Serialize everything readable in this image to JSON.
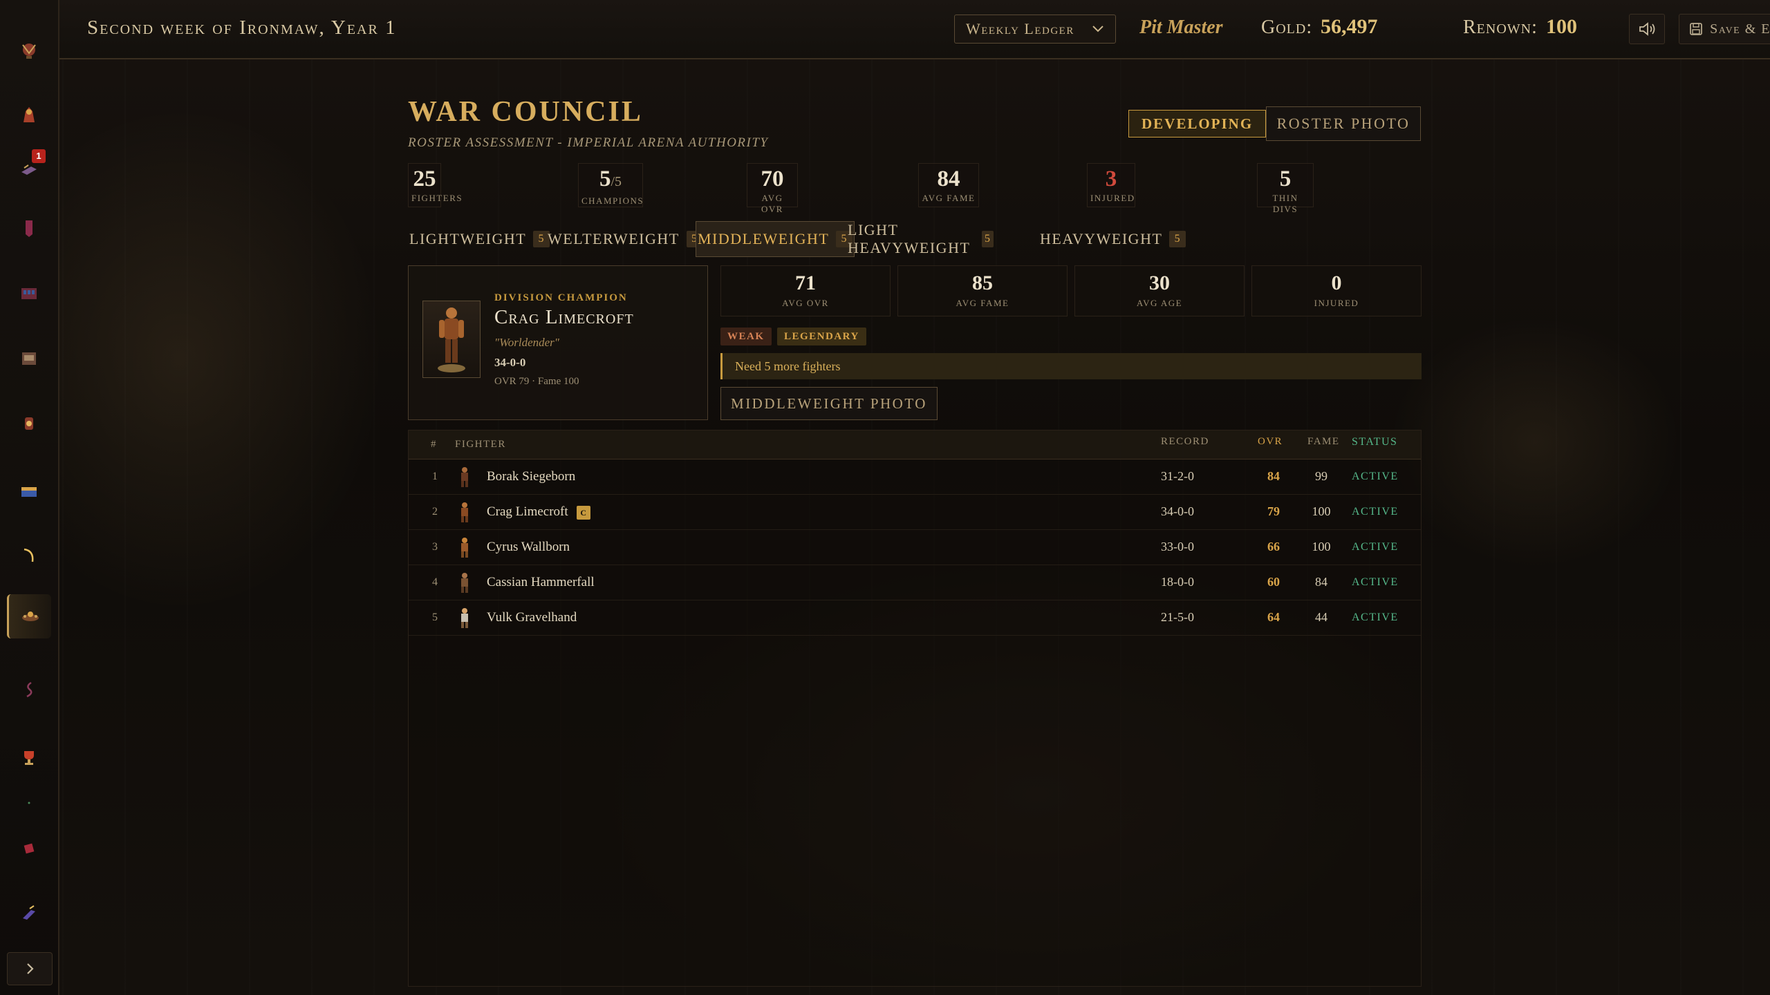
{
  "topbar": {
    "week_title": "Second week of Ironmaw, Year 1",
    "ledger_select": "Weekly Ledger",
    "role": "Pit Master",
    "gold_label": "Gold:",
    "gold_value": "56,497",
    "renown_label": "Renown:",
    "renown_value": "100",
    "save_exit_label": "Save & Exit"
  },
  "sidebar": {
    "badge_count": "1",
    "icons": [
      "skull-crest-icon",
      "warlord-icon",
      "messages-icon",
      "banner-icon",
      "arena-icon",
      "treasury-icon",
      "lantern-icon",
      "chest-icon",
      "scythe-icon",
      "war-council-icon",
      "serpent-icon",
      "trophy-icon",
      "dot-icon",
      "tome-icon",
      "forge-icon"
    ],
    "active_index": 9
  },
  "header": {
    "title": "WAR COUNCIL",
    "subtitle": "ROSTER ASSESSMENT - IMPERIAL ARENA AUTHORITY",
    "status_badge": "DEVELOPING",
    "roster_photo_label": "ROSTER PHOTO"
  },
  "stats": {
    "fighters": {
      "value": "25",
      "label": "Fighters"
    },
    "champions": {
      "value": "5",
      "total": "/5",
      "label": "Champions"
    },
    "avg_ovr": {
      "value": "70",
      "label": "Avg OVR"
    },
    "avg_fame": {
      "value": "84",
      "label": "Avg Fame"
    },
    "injured": {
      "value": "3",
      "label": "Injured"
    },
    "thin_divs": {
      "value": "5",
      "label": "Thin Divs"
    }
  },
  "tabs": [
    {
      "label": "Lightweight",
      "count": "5"
    },
    {
      "label": "Welterweight",
      "count": "5"
    },
    {
      "label": "Middleweight",
      "count": "5"
    },
    {
      "label": "Light Heavyweight",
      "count": "5"
    },
    {
      "label": "Heavyweight",
      "count": "5"
    }
  ],
  "active_tab": 2,
  "champion": {
    "label": "Division Champion",
    "name": "Crag Limecroft",
    "nickname": "\"Worldender\"",
    "record": "34-0-0",
    "meta": "OVR 79 · Fame 100"
  },
  "division": {
    "avg_ovr": {
      "value": "71",
      "label": "Avg OVR"
    },
    "avg_fame": {
      "value": "85",
      "label": "Avg Fame"
    },
    "avg_age": {
      "value": "30",
      "label": "Avg Age"
    },
    "injured": {
      "value": "0",
      "label": "Injured"
    },
    "tag_weak": "Weak",
    "tag_legendary": "Legendary",
    "warning": "Need 5 more fighters",
    "photo_label": "MIDDLEWEIGHT PHOTO"
  },
  "table": {
    "headers": {
      "idx": "#",
      "fighter": "Fighter",
      "record": "Record",
      "ovr": "OVR",
      "fame": "Fame",
      "status": "Status"
    },
    "rows": [
      {
        "idx": "1",
        "name": "Borak Siegeborn",
        "record": "31-2-0",
        "ovr": "84",
        "fame": "99",
        "status": "Active",
        "champ": ""
      },
      {
        "idx": "2",
        "name": "Crag Limecroft",
        "record": "34-0-0",
        "ovr": "79",
        "fame": "100",
        "status": "Active",
        "champ": "C"
      },
      {
        "idx": "3",
        "name": "Cyrus Wallborn",
        "record": "33-0-0",
        "ovr": "66",
        "fame": "100",
        "status": "Active",
        "champ": ""
      },
      {
        "idx": "4",
        "name": "Cassian Hammerfall",
        "record": "18-0-0",
        "ovr": "60",
        "fame": "84",
        "status": "Active",
        "champ": ""
      },
      {
        "idx": "5",
        "name": "Vulk Gravelhand",
        "record": "21-5-0",
        "ovr": "64",
        "fame": "44",
        "status": "Active",
        "champ": ""
      }
    ]
  },
  "colors": {
    "accent_gold": "#d7ad5e",
    "ovr": "#d9a449",
    "status_active": "#55b88a",
    "injured_red": "#d04a3c"
  }
}
